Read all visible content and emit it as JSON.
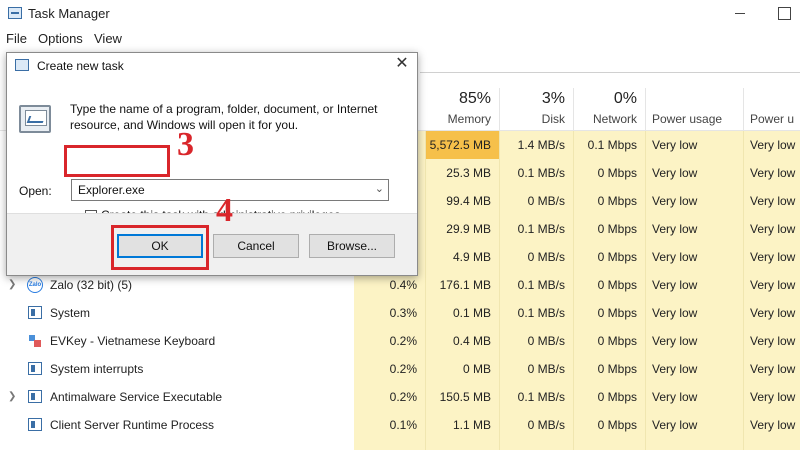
{
  "window": {
    "title": "Task Manager"
  },
  "menu": [
    "File",
    "Options",
    "View"
  ],
  "columns": {
    "memory": {
      "pct": "85%",
      "label": "Memory"
    },
    "disk": {
      "pct": "3%",
      "label": "Disk"
    },
    "network": {
      "pct": "0%",
      "label": "Network"
    },
    "power": {
      "label": "Power usage"
    },
    "power_trend": {
      "label": "Power u"
    }
  },
  "rows": [
    {
      "name": "",
      "cpu": "",
      "mem": "5,572.5 MB",
      "disk": "1.4 MB/s",
      "net": "0.1 Mbps",
      "power": "Very low",
      "trend": "Very low"
    },
    {
      "name": "",
      "cpu": "",
      "mem": "25.3 MB",
      "disk": "0.1 MB/s",
      "net": "0 Mbps",
      "power": "Very low",
      "trend": "Very low"
    },
    {
      "name": "",
      "cpu": "",
      "mem": "99.4 MB",
      "disk": "0 MB/s",
      "net": "0 Mbps",
      "power": "Very low",
      "trend": "Very low"
    },
    {
      "name": "",
      "cpu": "",
      "mem": "29.9 MB",
      "disk": "0.1 MB/s",
      "net": "0 Mbps",
      "power": "Very low",
      "trend": "Very low"
    },
    {
      "name": "",
      "cpu": "",
      "mem": "4.9 MB",
      "disk": "0 MB/s",
      "net": "0 Mbps",
      "power": "Very low",
      "trend": "Very low"
    },
    {
      "name": "Zalo (32 bit) (5)",
      "cpu": "0.4%",
      "mem": "176.1 MB",
      "disk": "0.1 MB/s",
      "net": "0 Mbps",
      "power": "Very low",
      "trend": "Very low"
    },
    {
      "name": "System",
      "cpu": "0.3%",
      "mem": "0.1 MB",
      "disk": "0.1 MB/s",
      "net": "0 Mbps",
      "power": "Very low",
      "trend": "Very low"
    },
    {
      "name": "EVKey - Vietnamese Keyboard",
      "cpu": "0.2%",
      "mem": "0.4 MB",
      "disk": "0 MB/s",
      "net": "0 Mbps",
      "power": "Very low",
      "trend": "Very low"
    },
    {
      "name": "System interrupts",
      "cpu": "0.2%",
      "mem": "0 MB",
      "disk": "0 MB/s",
      "net": "0 Mbps",
      "power": "Very low",
      "trend": "Very low"
    },
    {
      "name": "Antimalware Service Executable",
      "cpu": "0.2%",
      "mem": "150.5 MB",
      "disk": "0.1 MB/s",
      "net": "0 Mbps",
      "power": "Very low",
      "trend": "Very low"
    },
    {
      "name": "Client Server Runtime Process",
      "cpu": "0.1%",
      "mem": "1.1 MB",
      "disk": "0 MB/s",
      "net": "0 Mbps",
      "power": "Very low",
      "trend": "Very low"
    }
  ],
  "dialog": {
    "title": "Create new task",
    "description": "Type the name of a program, folder, document, or Internet resource, and Windows will open it for you.",
    "open_label": "Open:",
    "open_value": "Explorer.exe",
    "admin_label": "Create this task with administrative privileges.",
    "ok": "OK",
    "cancel": "Cancel",
    "browse": "Browse..."
  },
  "annotations": {
    "step3": "3",
    "step4": "4",
    "color": "#d9262b"
  }
}
